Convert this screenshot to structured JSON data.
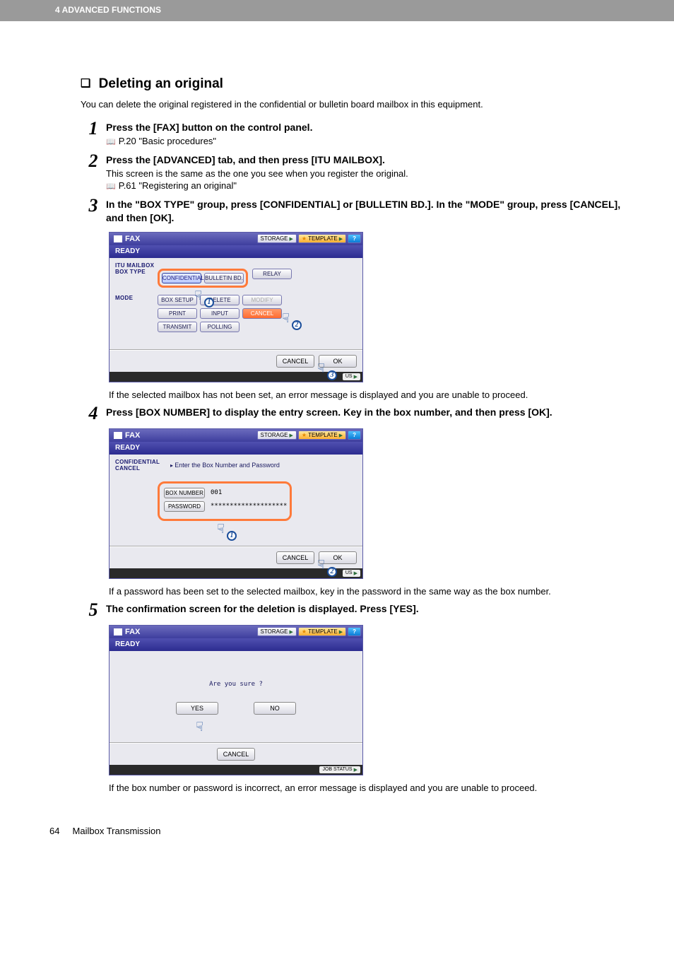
{
  "header": {
    "breadcrumb": "4 ADVANCED FUNCTIONS"
  },
  "section_title": "Deleting an original",
  "intro": "You can delete the original registered in the confidential or bulletin board mailbox in this equipment.",
  "steps": {
    "s1": {
      "num": "1",
      "instr": "Press the [FAX] button on the control panel.",
      "ref": "P.20 \"Basic procedures\""
    },
    "s2": {
      "num": "2",
      "instr": "Press the [ADVANCED] tab, and then press [ITU MAILBOX].",
      "sub": "This screen is the same as the one you see when you register the original.",
      "ref": "P.61 \"Registering an original\""
    },
    "s3": {
      "num": "3",
      "instr": "In the \"BOX TYPE\" group, press [CONFIDENTIAL] or [BULLETIN BD.]. In the \"MODE\" group, press [CANCEL], and then [OK].",
      "note": "If the selected mailbox has not been set, an error message is displayed and you are unable to proceed."
    },
    "s4": {
      "num": "4",
      "instr": "Press [BOX NUMBER] to display the entry screen. Key in the box number, and then press [OK].",
      "note": "If a password has been set to the selected mailbox, key in the password in the same way as the box number."
    },
    "s5": {
      "num": "5",
      "instr": "The confirmation screen for the deletion is displayed. Press [YES].",
      "note": "If the box number or password is incorrect, an error message is displayed and you are unable to proceed."
    }
  },
  "screen_common": {
    "fax_title": "FAX",
    "storage": "STORAGE",
    "template": "TEMPLATE",
    "help": "?",
    "ready": "READY",
    "cancel": "CANCEL",
    "ok": "OK",
    "job_status_suffix": "US",
    "job_status_full": "JOB STATUS"
  },
  "screen1": {
    "label_itu": "ITU MAILBOX",
    "label_boxtype": "BOX TYPE",
    "label_mode": "MODE",
    "bt_conf": "CONFIDENTIAL",
    "bt_bull": "BULLETIN BD.",
    "bt_relay": "RELAY",
    "m_boxsetup": "BOX SETUP",
    "m_delete": "DELETE",
    "m_modify": "MODIFY",
    "m_print": "PRINT",
    "m_input": "INPUT",
    "m_cancel": "CANCEL",
    "m_transmit": "TRANSMIT",
    "m_polling": "POLLING",
    "marker1": "1",
    "marker2": "2",
    "marker3": "3"
  },
  "screen2": {
    "side_line1": "CONFIDENTIAL",
    "side_line2": "CANCEL",
    "prompt": "Enter the Box Number and Password",
    "boxnumber_btn": "BOX NUMBER",
    "password_btn": "PASSWORD",
    "boxnumber_val": "001",
    "password_val": "********************",
    "marker1": "1",
    "marker2": "2"
  },
  "screen3": {
    "question": "Are you sure ?",
    "yes": "YES",
    "no": "NO"
  },
  "footer": {
    "page_no": "64",
    "section": "Mailbox Transmission"
  }
}
